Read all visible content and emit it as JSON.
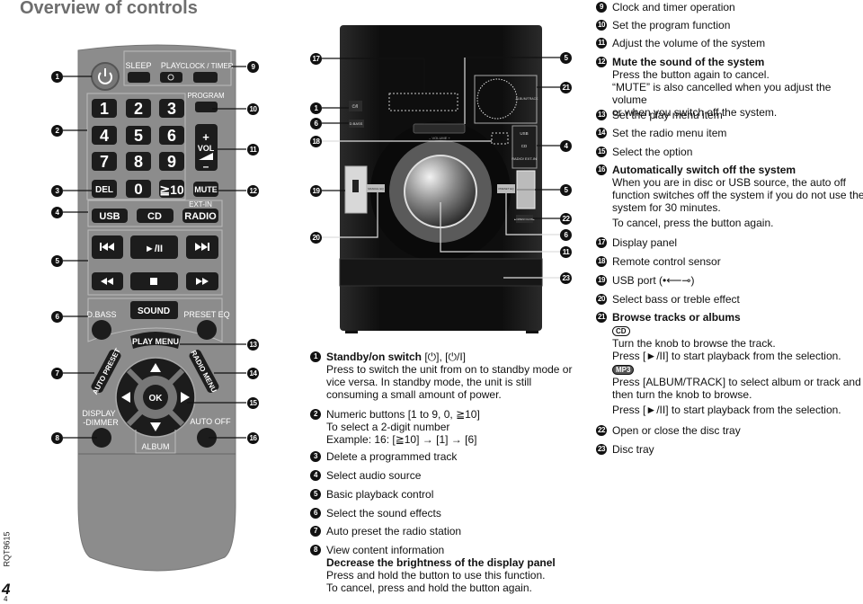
{
  "page": {
    "title": "Overview of controls",
    "side_code": "RQT9615",
    "page_number": "4",
    "page_number_small": "4"
  },
  "remote": {
    "sleep": "SLEEP",
    "play": "PLAY",
    "clock_timer": "CLOCK / TIMER",
    "program": "PROGRAM",
    "keys": [
      "1",
      "2",
      "3",
      "4",
      "5",
      "6",
      "7",
      "8",
      "9"
    ],
    "del": "DEL",
    "zero": "0",
    "ten": "≧10",
    "vol": "VOL",
    "vol_plus": "+",
    "vol_minus": "–",
    "mute": "MUTE",
    "ext_in": "EXT-IN",
    "usb": "USB",
    "cd": "CD",
    "radio": "RADIO",
    "play_pause": "►/II",
    "sound": "SOUND",
    "dbass": "D.BASS",
    "preset_eq": "PRESET EQ",
    "play_menu": "PLAY MENU",
    "auto_preset": "AUTO PRESET",
    "radio_menu": "RADIO MENU",
    "ok": "OK",
    "display": "DISPLAY",
    "dimmer": "-DIMMER",
    "auto_off": "AUTO OFF",
    "album": "ALBUM",
    "callouts_left": [
      "1",
      "2",
      "3",
      "4",
      "5",
      "6",
      "7",
      "8"
    ],
    "callouts_right": [
      "9",
      "10",
      "11",
      "12",
      "13",
      "14",
      "15",
      "16"
    ]
  },
  "unit": {
    "standby": "⏻/I",
    "dbass": "D.BASS",
    "volume": "– VOLUME +",
    "usb": "USB",
    "cd": "CD",
    "radio": "RADIO/ EXT-IN",
    "album_track": "ALBUM/TRACK",
    "manual_eq": "MANUAL EQ",
    "preset_eq": "PRESET EQ",
    "open_close": "▲OPEN/ CLOSE",
    "callouts_left": [
      "17",
      "1",
      "6",
      "18",
      "19",
      "20"
    ],
    "callouts_right": [
      "5",
      "21",
      "4",
      "5",
      "22",
      "6",
      "11",
      "23"
    ]
  },
  "descriptions_left": [
    {
      "num": "1",
      "heading": "Standby/on switch",
      "heading_bold": true,
      "heading_suffix": " [⏻], [⏻/I]",
      "lines": [
        {
          "text": "Press to switch the unit from on to standby mode or"
        },
        {
          "text": "vice versa. In standby mode, the unit is still"
        },
        {
          "text": "consuming a small amount of power."
        }
      ]
    },
    {
      "num": "2",
      "heading": "Numeric buttons [1 to 9, 0, ≧10]",
      "lines": [
        {
          "text": "To select a 2-digit number"
        },
        {
          "text": "Example: 16: [≧10] → [1] → [6]"
        }
      ]
    },
    {
      "num": "3",
      "heading": "Delete a programmed track",
      "lines": []
    },
    {
      "num": "4",
      "heading": "Select audio source",
      "lines": []
    },
    {
      "num": "5",
      "heading": "Basic playback control",
      "lines": []
    },
    {
      "num": "6",
      "heading": "Select the sound effects",
      "lines": []
    },
    {
      "num": "7",
      "heading": "Auto preset the radio station",
      "lines": []
    },
    {
      "num": "8",
      "heading": "View content information",
      "lines": [
        {
          "text": "Decrease the brightness of the display panel",
          "bold": true
        },
        {
          "text": "Press and hold the button to use this function."
        },
        {
          "text": "To cancel, press and hold the button again."
        }
      ]
    }
  ],
  "descriptions_right": [
    {
      "num": "9",
      "heading": "Clock and timer operation",
      "lines": []
    },
    {
      "num": "10",
      "heading": "Set the program function",
      "lines": []
    },
    {
      "num": "11",
      "heading": "Adjust the volume of the system",
      "lines": []
    },
    {
      "num": "12",
      "heading": "Mute the sound of the system",
      "heading_bold": true,
      "lines": [
        {
          "text": "Press the button again to cancel."
        },
        {
          "text": "“MUTE” is also cancelled when you adjust the volume"
        },
        {
          "text": "or when you switch off the system."
        }
      ]
    },
    {
      "num": "13",
      "heading": "Set the play menu item",
      "lines": []
    },
    {
      "num": "14",
      "heading": "Set the radio menu item",
      "lines": []
    },
    {
      "num": "15",
      "heading": "Select the option",
      "lines": []
    },
    {
      "num": "16",
      "heading": "Automatically switch off the system",
      "heading_bold": true,
      "lines": [
        {
          "text": "When you are in disc or USB source, the auto off"
        },
        {
          "text": "function switches off the system if you do not use the"
        },
        {
          "text": "system for 30 minutes."
        },
        {
          "text": "To cancel, press the button again.",
          "gap": true
        }
      ]
    },
    {
      "num": "17",
      "heading": "Display panel",
      "lines": []
    },
    {
      "num": "18",
      "heading": "Remote control sensor",
      "lines": []
    },
    {
      "num": "19",
      "heading": "USB port (•⟵⊸)",
      "lines": []
    },
    {
      "num": "20",
      "heading": "Select bass or treble effect",
      "lines": []
    },
    {
      "num": "21",
      "heading": "Browse tracks or albums",
      "heading_bold": true,
      "lines": [
        {
          "badge": "CD"
        },
        {
          "text": "Turn the knob to browse the track."
        },
        {
          "text": "Press [►/II] to start playback from the selection."
        },
        {
          "badge": "MP3",
          "dark": true
        },
        {
          "text": "Press [ALBUM/TRACK] to select album or track and"
        },
        {
          "text": "then turn the knob to browse."
        },
        {
          "text": "Press [►/II] to start playback from the selection.",
          "gap": true
        }
      ]
    },
    {
      "num": "22",
      "heading": "Open or close the disc tray",
      "lines": []
    },
    {
      "num": "23",
      "heading": "Disc tray",
      "lines": []
    }
  ],
  "colors": {
    "remote_body": "#8c8c8c",
    "button": "#1c1c1c",
    "unit_body": "#141414",
    "title": "#6e6e6e"
  }
}
